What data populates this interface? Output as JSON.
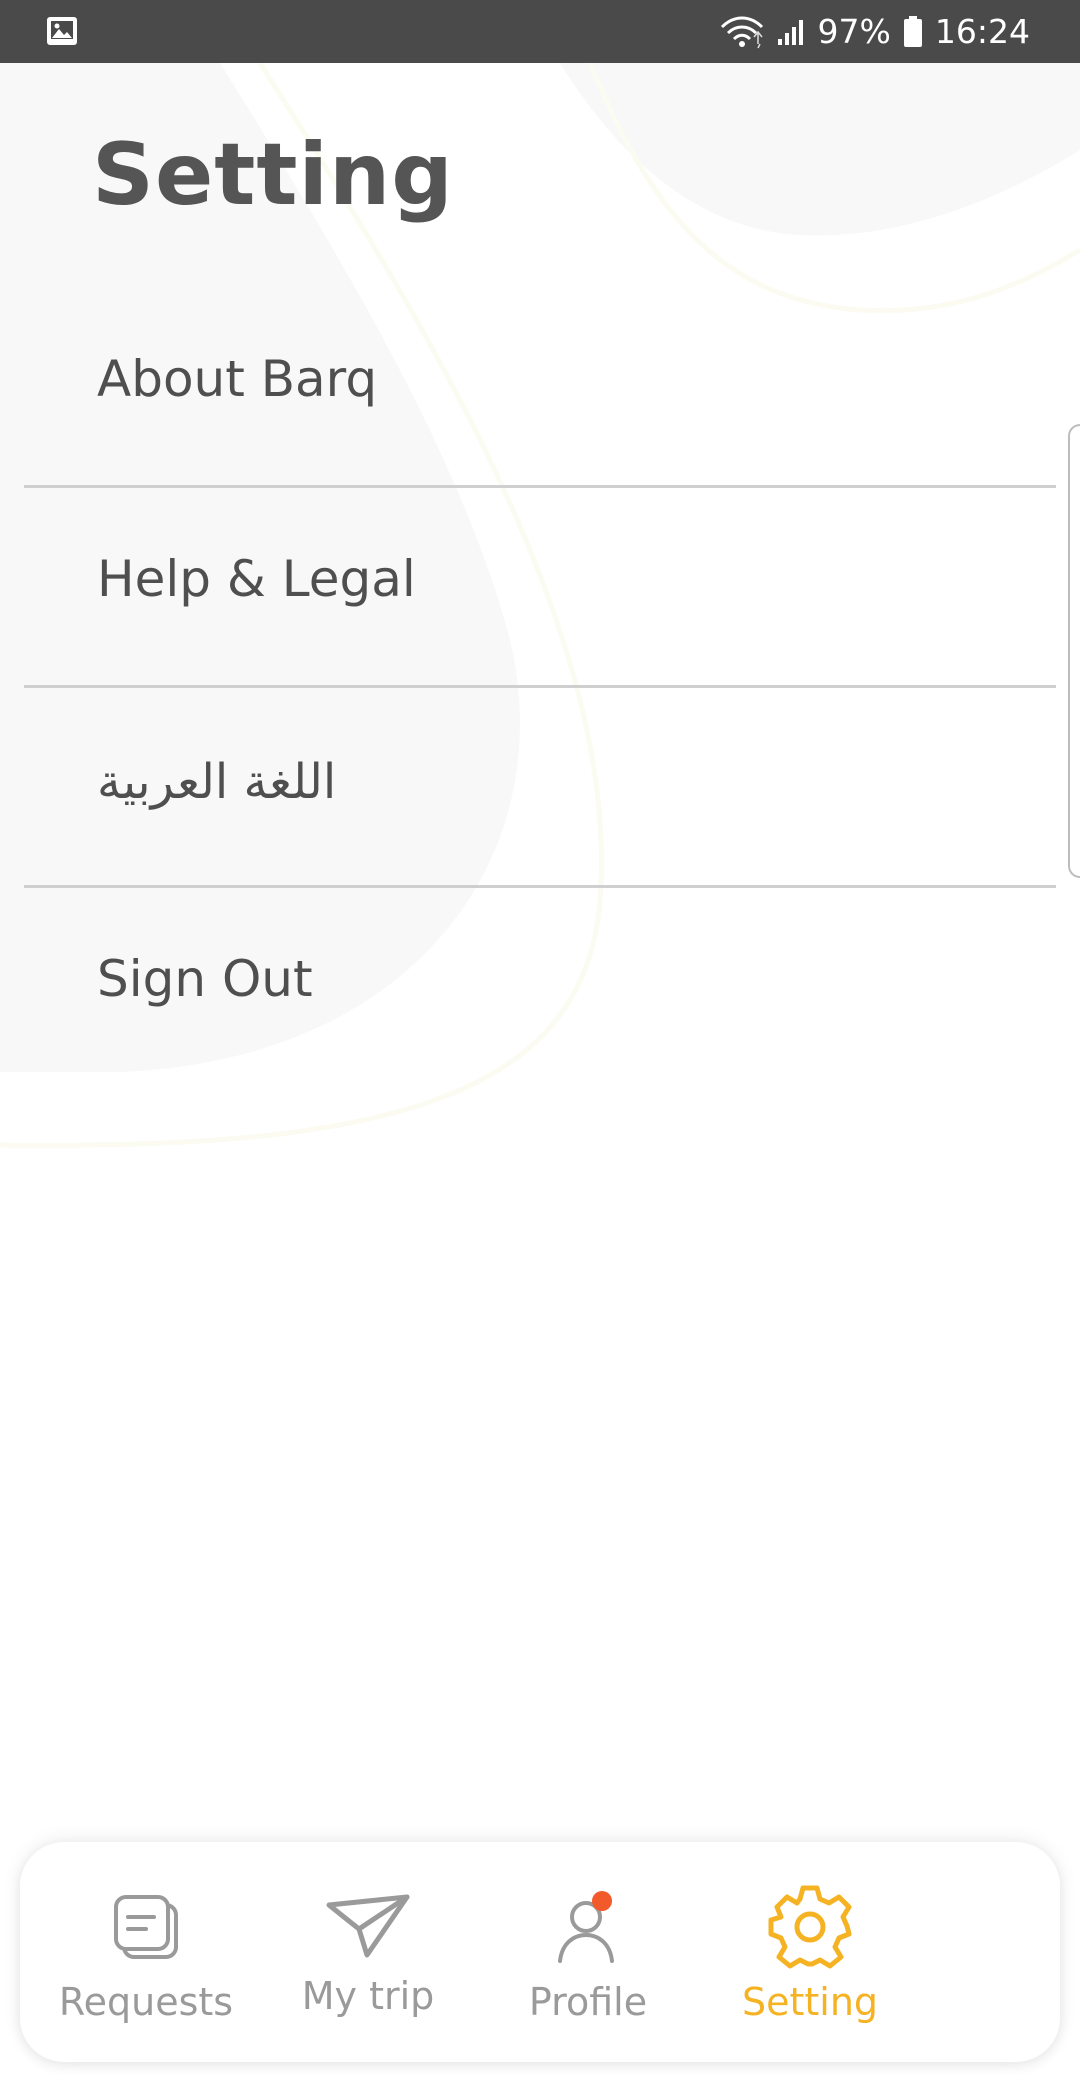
{
  "status_bar": {
    "left_icon": "image-notification-icon",
    "battery_percent": "97%",
    "time": "16:24"
  },
  "page": {
    "title": "Setting"
  },
  "menu": {
    "items": [
      {
        "label": "About Barq"
      },
      {
        "label": "Help & Legal"
      },
      {
        "label": "اللغة العربية"
      },
      {
        "label": "Sign Out"
      }
    ]
  },
  "bottom_nav": {
    "items": [
      {
        "label": "Requests",
        "icon": "requests-icon"
      },
      {
        "label": "My trip",
        "icon": "paper-plane-icon"
      },
      {
        "label": "Profile",
        "icon": "person-icon"
      },
      {
        "label": "Setting",
        "icon": "gear-icon"
      }
    ],
    "active": "Setting"
  },
  "colors": {
    "accent": "#f5b324",
    "notification_dot": "#f25a2b",
    "text": "#4f4f4f",
    "inactive": "#9a9a9a"
  }
}
